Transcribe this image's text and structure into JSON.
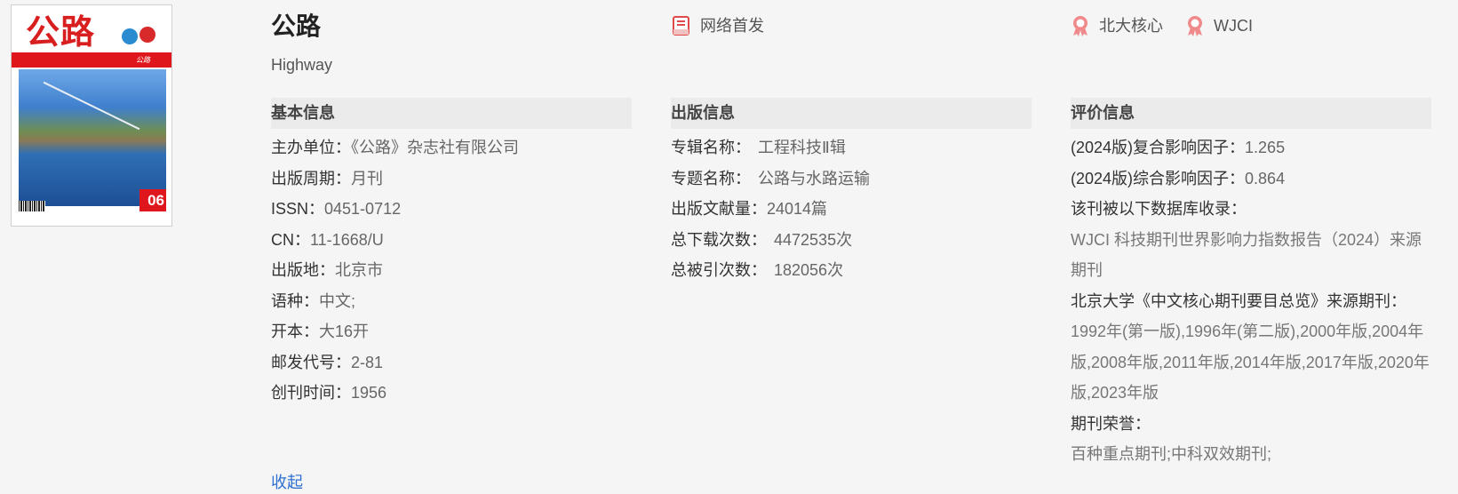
{
  "cover": {
    "title": "公路",
    "issue": "06",
    "band_text": "公路"
  },
  "header": {
    "title": "公路",
    "english": "Highway",
    "tags": [
      {
        "label": "网络首发",
        "icon": "web-first-icon"
      },
      {
        "label": "北大核心",
        "icon": "award-icon"
      },
      {
        "label": "WJCI",
        "icon": "award-icon"
      }
    ]
  },
  "basic_info": {
    "heading": "基本信息",
    "rows": [
      {
        "label": "主办单位：",
        "value": "《公路》杂志社有限公司"
      },
      {
        "label": "出版周期：",
        "value": "月刊"
      },
      {
        "label": "ISSN：",
        "value": "0451-0712"
      },
      {
        "label": "CN：",
        "value": "11-1668/U"
      },
      {
        "label": "出版地：",
        "value": "北京市"
      },
      {
        "label": "语种：",
        "value": "中文;"
      },
      {
        "label": "开本：",
        "value": "大16开"
      },
      {
        "label": "邮发代号：",
        "value": "2-81"
      },
      {
        "label": "创刊时间：",
        "value": "1956"
      }
    ]
  },
  "pub_info": {
    "heading": "出版信息",
    "rows": [
      {
        "label": "专辑名称：",
        "value": "工程科技Ⅱ辑"
      },
      {
        "label": "专题名称：",
        "value": "公路与水路运输"
      },
      {
        "label": "出版文献量：",
        "value": "24014篇"
      },
      {
        "label": "总下载次数：",
        "value": "4472535次"
      },
      {
        "label": "总被引次数：",
        "value": "182056次"
      }
    ]
  },
  "eval_info": {
    "heading": "评价信息",
    "composite_if_label": "(2024版)复合影响因子：",
    "composite_if": "1.265",
    "comprehensive_if_label": "(2024版)综合影响因子：",
    "comprehensive_if": "0.864",
    "db_label": "该刊被以下数据库收录：",
    "db_text": "WJCI 科技期刊世界影响力指数报告（2024）来源期刊",
    "pku_label": "北京大学《中文核心期刊要目总览》来源期刊：",
    "pku_text": "1992年(第一版),1996年(第二版),2000年版,2004年版,2008年版,2011年版,2014年版,2017年版,2020年版,2023年版",
    "honor_label": "期刊荣誉：",
    "honor_text": "百种重点期刊;中科双效期刊;"
  },
  "more_link": "收起"
}
